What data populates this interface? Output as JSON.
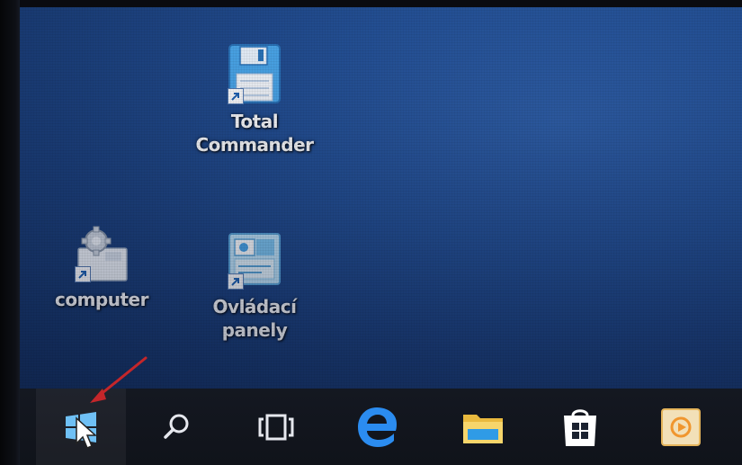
{
  "desktop": {
    "icons": [
      {
        "label_line1": "Total",
        "label_line2": "Commander",
        "icon": "floppy-disk-icon"
      },
      {
        "label_line1": "computer",
        "label_line2": "",
        "icon": "computer-settings-icon"
      },
      {
        "label_line1": "Ovládací",
        "label_line2": "panely",
        "icon": "control-panel-icon"
      }
    ]
  },
  "taskbar": {
    "items": [
      {
        "icon": "windows-start-icon"
      },
      {
        "icon": "search-icon"
      },
      {
        "icon": "task-view-icon"
      },
      {
        "icon": "edge-icon"
      },
      {
        "icon": "file-explorer-icon"
      },
      {
        "icon": "store-icon"
      },
      {
        "icon": "media-app-icon"
      }
    ]
  },
  "colors": {
    "desktop_blue": "#234f93",
    "taskbar": "#12151c",
    "annotation_arrow": "#c4262a",
    "edge_blue": "#2b8cf0",
    "folder_yellow": "#f3d46a"
  }
}
